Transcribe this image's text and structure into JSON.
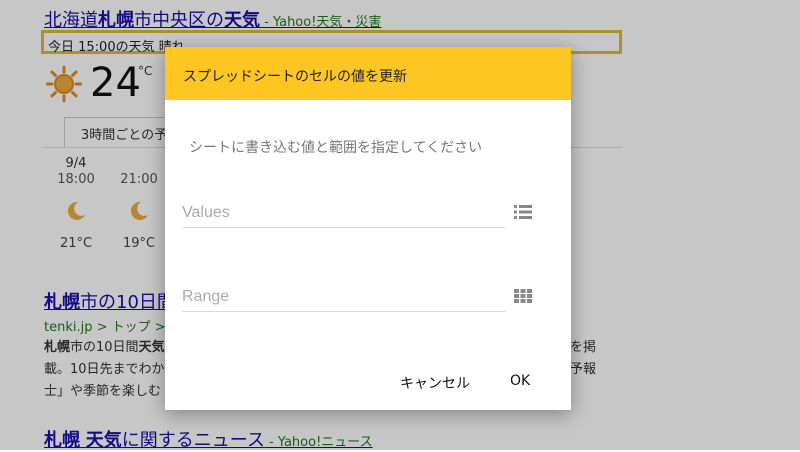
{
  "background": {
    "result1": {
      "title_pre": "北海道",
      "title_b1": "札幌",
      "title_mid": "市中央区の",
      "title_b2": "天気",
      "source": " - Yahoo!天気・災害"
    },
    "highlight_text": "今日 15:00の天気 晴れ",
    "current": {
      "icon": "sun-icon",
      "temp": "24",
      "unit": "°C"
    },
    "tab_label": "3時間ごとの予報",
    "hours": [
      {
        "date": "9/4",
        "time": "18:00",
        "icon": "moon-icon",
        "temp": "21°C"
      },
      {
        "date": "",
        "time": "21:00",
        "icon": "moon-icon",
        "temp": "19°C"
      }
    ],
    "result2": {
      "title_b": "札幌",
      "title_rest": "市の10日間",
      "url": "tenki.jp > トップ > 北",
      "snippet_b1": "札幌",
      "snippet_t1": "市の10日間",
      "snippet_b2": "天気",
      "snippet_line2": "載。10日先までわか",
      "snippet_line3": "士」や季節を楽しむ",
      "right_line1": "を掲",
      "right_line2": "予報"
    },
    "result3": {
      "title_b1": "札幌",
      "title_sp": " ",
      "title_b2": "天気",
      "title_rest": "に関するニュース",
      "source": " - Yahoo!ニュース"
    }
  },
  "dialog": {
    "title": "スプレッドシートのセルの値を更新",
    "instruction": "シートに書き込む値と範囲を指定してください",
    "values_placeholder": "Values",
    "values_icon": "list-icon",
    "range_placeholder": "Range",
    "range_icon": "grid-icon",
    "cancel_label": "キャンセル",
    "ok_label": "OK",
    "header_color": "#fdc623"
  }
}
